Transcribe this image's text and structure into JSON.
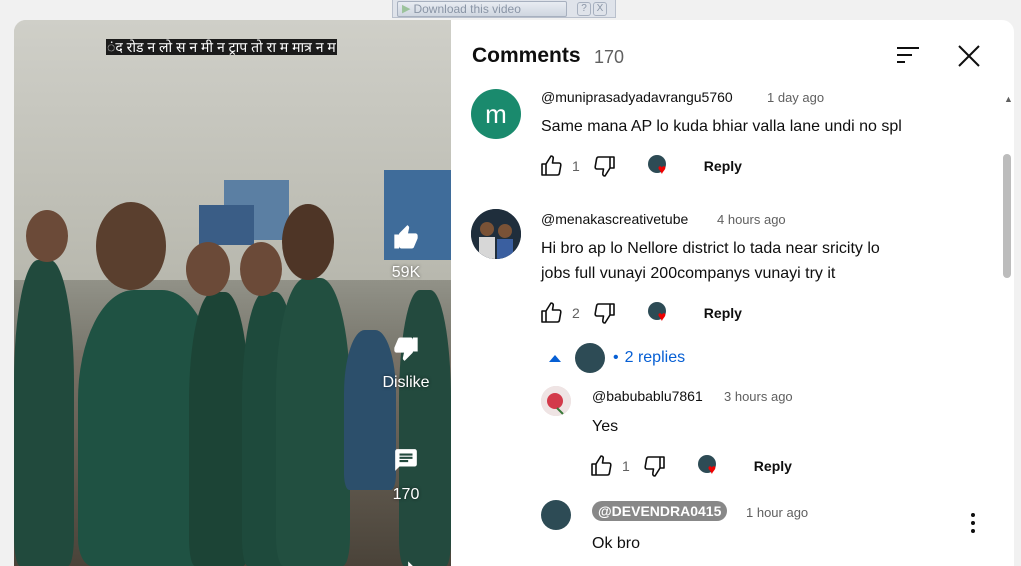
{
  "download_bar": {
    "label": "Download this video",
    "help": "?",
    "close": "X"
  },
  "video": {
    "caption": "ंद रोड न लो स न मी न ट्राप तो रा म मात्र न म",
    "likes": "59K",
    "dislike_label": "Dislike",
    "comments_count": "170"
  },
  "panel": {
    "title": "Comments",
    "count": "170"
  },
  "comments": [
    {
      "author": "@muniprasadyadavrangu5760",
      "time": "1 day ago",
      "avatar_letter": "m",
      "avatar_color": "#1a8a6d",
      "text": "Same mana AP lo kuda bhiar valla lane undi no spl",
      "likes": "1",
      "reply_label": "Reply"
    },
    {
      "author": "@menakascreativetube",
      "time": "4 hours ago",
      "text_line1": "Hi bro ap lo Nellore district lo tada near sricity lo",
      "text_line2": "jobs full vunayi 200companys vunayi try it",
      "likes": "2",
      "reply_label": "Reply"
    }
  ],
  "replies_toggle": {
    "dot": "•",
    "label": "2 replies"
  },
  "replies": [
    {
      "author": "@babubablu7861",
      "time": "3 hours ago",
      "text": "Yes",
      "likes": "1",
      "reply_label": "Reply"
    },
    {
      "author": "@DEVENDRA0415",
      "time": "1 hour ago",
      "text": "Ok bro"
    }
  ],
  "colors": {
    "link_blue": "#065fd4",
    "heart_red": "#e00000",
    "text": "#0f0f0f",
    "muted": "#606060"
  }
}
